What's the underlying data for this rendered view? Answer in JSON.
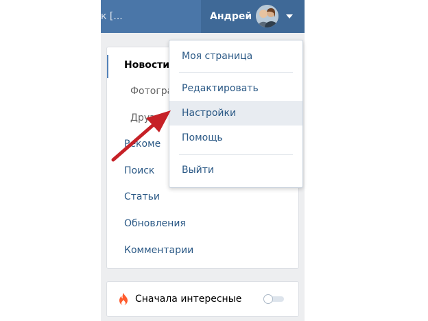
{
  "header": {
    "search_fragment": "к [...",
    "user_name": "Андрей"
  },
  "nav": {
    "items": [
      {
        "label": "Новости",
        "active": true
      },
      {
        "label": "Фотогра",
        "sub": true
      },
      {
        "label": "Друзья",
        "sub": true
      },
      {
        "label": "Рекоме"
      },
      {
        "label": "Поиск"
      },
      {
        "label": "Статьи"
      },
      {
        "label": "Обновления"
      },
      {
        "label": "Комментарии"
      }
    ]
  },
  "dropdown": {
    "items": [
      {
        "label": "Моя страница"
      },
      {
        "label": "Редактировать"
      },
      {
        "label": "Настройки",
        "hovered": true
      },
      {
        "label": "Помощь"
      },
      {
        "label": "Выйти"
      }
    ]
  },
  "feed_settings": {
    "label": "Сначала интересные",
    "toggle_on": false
  },
  "colors": {
    "header_bg": "#4a76a8",
    "link": "#2a5885",
    "arrow": "#c62127",
    "flame": "#ff5c2e"
  },
  "icons": {
    "flame": "flame-icon",
    "caret": "chevron-down-icon",
    "pointer": "red-arrow-annotation"
  }
}
